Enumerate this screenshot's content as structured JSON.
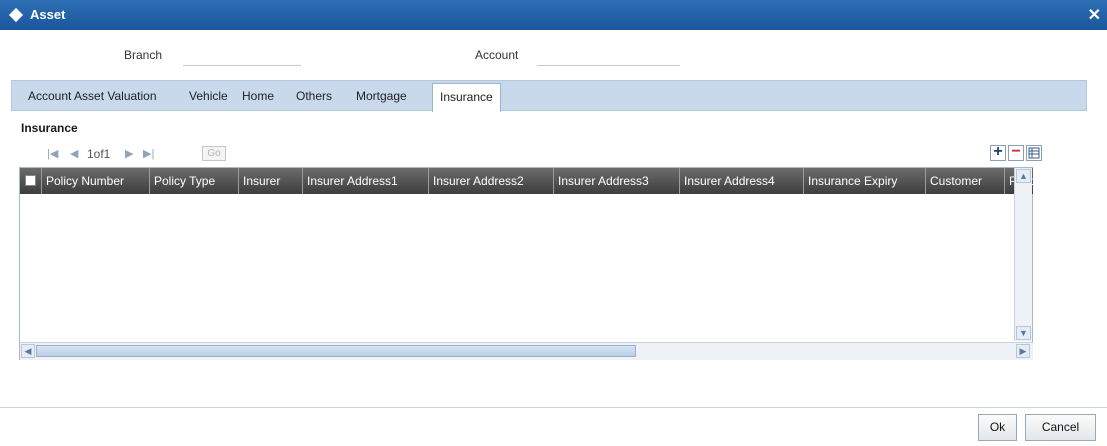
{
  "window": {
    "title": "Asset",
    "close_icon": "close-icon"
  },
  "fields": {
    "branch_label": "Branch",
    "branch_value": "",
    "account_label": "Account",
    "account_value": ""
  },
  "tabs": [
    {
      "label": "Account Asset Valuation",
      "active": false
    },
    {
      "label": "Vehicle",
      "active": false
    },
    {
      "label": "Home",
      "active": false
    },
    {
      "label": "Others",
      "active": false
    },
    {
      "label": "Mortgage",
      "active": false
    },
    {
      "label": "Insurance",
      "active": true
    }
  ],
  "section": {
    "title": "Insurance"
  },
  "pager": {
    "text": "1of1",
    "go_label": "Go"
  },
  "grid": {
    "columns": [
      "Policy Number",
      "Policy Type",
      "Insurer",
      "Insurer Address1",
      "Insurer Address2",
      "Insurer Address3",
      "Insurer Address4",
      "Insurance Expiry",
      "Customer",
      "Polic"
    ],
    "rows": []
  },
  "buttons": {
    "ok": "Ok",
    "cancel": "Cancel"
  },
  "colors": {
    "titlebar": "#1a569c",
    "tabstrip": "#c8d9ec",
    "header": "#4d4d4d"
  }
}
